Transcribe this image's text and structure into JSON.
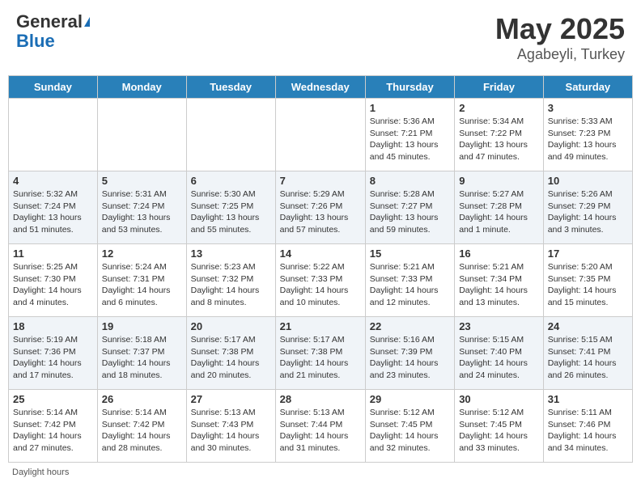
{
  "header": {
    "logo_general": "General",
    "logo_blue": "Blue",
    "month": "May 2025",
    "location": "Agabeyli, Turkey"
  },
  "days_of_week": [
    "Sunday",
    "Monday",
    "Tuesday",
    "Wednesday",
    "Thursday",
    "Friday",
    "Saturday"
  ],
  "weeks": [
    [
      {
        "day": "",
        "sunrise": "",
        "sunset": "",
        "daylight": ""
      },
      {
        "day": "",
        "sunrise": "",
        "sunset": "",
        "daylight": ""
      },
      {
        "day": "",
        "sunrise": "",
        "sunset": "",
        "daylight": ""
      },
      {
        "day": "",
        "sunrise": "",
        "sunset": "",
        "daylight": ""
      },
      {
        "day": "1",
        "sunrise": "Sunrise: 5:36 AM",
        "sunset": "Sunset: 7:21 PM",
        "daylight": "Daylight: 13 hours and 45 minutes."
      },
      {
        "day": "2",
        "sunrise": "Sunrise: 5:34 AM",
        "sunset": "Sunset: 7:22 PM",
        "daylight": "Daylight: 13 hours and 47 minutes."
      },
      {
        "day": "3",
        "sunrise": "Sunrise: 5:33 AM",
        "sunset": "Sunset: 7:23 PM",
        "daylight": "Daylight: 13 hours and 49 minutes."
      }
    ],
    [
      {
        "day": "4",
        "sunrise": "Sunrise: 5:32 AM",
        "sunset": "Sunset: 7:24 PM",
        "daylight": "Daylight: 13 hours and 51 minutes."
      },
      {
        "day": "5",
        "sunrise": "Sunrise: 5:31 AM",
        "sunset": "Sunset: 7:24 PM",
        "daylight": "Daylight: 13 hours and 53 minutes."
      },
      {
        "day": "6",
        "sunrise": "Sunrise: 5:30 AM",
        "sunset": "Sunset: 7:25 PM",
        "daylight": "Daylight: 13 hours and 55 minutes."
      },
      {
        "day": "7",
        "sunrise": "Sunrise: 5:29 AM",
        "sunset": "Sunset: 7:26 PM",
        "daylight": "Daylight: 13 hours and 57 minutes."
      },
      {
        "day": "8",
        "sunrise": "Sunrise: 5:28 AM",
        "sunset": "Sunset: 7:27 PM",
        "daylight": "Daylight: 13 hours and 59 minutes."
      },
      {
        "day": "9",
        "sunrise": "Sunrise: 5:27 AM",
        "sunset": "Sunset: 7:28 PM",
        "daylight": "Daylight: 14 hours and 1 minute."
      },
      {
        "day": "10",
        "sunrise": "Sunrise: 5:26 AM",
        "sunset": "Sunset: 7:29 PM",
        "daylight": "Daylight: 14 hours and 3 minutes."
      }
    ],
    [
      {
        "day": "11",
        "sunrise": "Sunrise: 5:25 AM",
        "sunset": "Sunset: 7:30 PM",
        "daylight": "Daylight: 14 hours and 4 minutes."
      },
      {
        "day": "12",
        "sunrise": "Sunrise: 5:24 AM",
        "sunset": "Sunset: 7:31 PM",
        "daylight": "Daylight: 14 hours and 6 minutes."
      },
      {
        "day": "13",
        "sunrise": "Sunrise: 5:23 AM",
        "sunset": "Sunset: 7:32 PM",
        "daylight": "Daylight: 14 hours and 8 minutes."
      },
      {
        "day": "14",
        "sunrise": "Sunrise: 5:22 AM",
        "sunset": "Sunset: 7:33 PM",
        "daylight": "Daylight: 14 hours and 10 minutes."
      },
      {
        "day": "15",
        "sunrise": "Sunrise: 5:21 AM",
        "sunset": "Sunset: 7:33 PM",
        "daylight": "Daylight: 14 hours and 12 minutes."
      },
      {
        "day": "16",
        "sunrise": "Sunrise: 5:21 AM",
        "sunset": "Sunset: 7:34 PM",
        "daylight": "Daylight: 14 hours and 13 minutes."
      },
      {
        "day": "17",
        "sunrise": "Sunrise: 5:20 AM",
        "sunset": "Sunset: 7:35 PM",
        "daylight": "Daylight: 14 hours and 15 minutes."
      }
    ],
    [
      {
        "day": "18",
        "sunrise": "Sunrise: 5:19 AM",
        "sunset": "Sunset: 7:36 PM",
        "daylight": "Daylight: 14 hours and 17 minutes."
      },
      {
        "day": "19",
        "sunrise": "Sunrise: 5:18 AM",
        "sunset": "Sunset: 7:37 PM",
        "daylight": "Daylight: 14 hours and 18 minutes."
      },
      {
        "day": "20",
        "sunrise": "Sunrise: 5:17 AM",
        "sunset": "Sunset: 7:38 PM",
        "daylight": "Daylight: 14 hours and 20 minutes."
      },
      {
        "day": "21",
        "sunrise": "Sunrise: 5:17 AM",
        "sunset": "Sunset: 7:38 PM",
        "daylight": "Daylight: 14 hours and 21 minutes."
      },
      {
        "day": "22",
        "sunrise": "Sunrise: 5:16 AM",
        "sunset": "Sunset: 7:39 PM",
        "daylight": "Daylight: 14 hours and 23 minutes."
      },
      {
        "day": "23",
        "sunrise": "Sunrise: 5:15 AM",
        "sunset": "Sunset: 7:40 PM",
        "daylight": "Daylight: 14 hours and 24 minutes."
      },
      {
        "day": "24",
        "sunrise": "Sunrise: 5:15 AM",
        "sunset": "Sunset: 7:41 PM",
        "daylight": "Daylight: 14 hours and 26 minutes."
      }
    ],
    [
      {
        "day": "25",
        "sunrise": "Sunrise: 5:14 AM",
        "sunset": "Sunset: 7:42 PM",
        "daylight": "Daylight: 14 hours and 27 minutes."
      },
      {
        "day": "26",
        "sunrise": "Sunrise: 5:14 AM",
        "sunset": "Sunset: 7:42 PM",
        "daylight": "Daylight: 14 hours and 28 minutes."
      },
      {
        "day": "27",
        "sunrise": "Sunrise: 5:13 AM",
        "sunset": "Sunset: 7:43 PM",
        "daylight": "Daylight: 14 hours and 30 minutes."
      },
      {
        "day": "28",
        "sunrise": "Sunrise: 5:13 AM",
        "sunset": "Sunset: 7:44 PM",
        "daylight": "Daylight: 14 hours and 31 minutes."
      },
      {
        "day": "29",
        "sunrise": "Sunrise: 5:12 AM",
        "sunset": "Sunset: 7:45 PM",
        "daylight": "Daylight: 14 hours and 32 minutes."
      },
      {
        "day": "30",
        "sunrise": "Sunrise: 5:12 AM",
        "sunset": "Sunset: 7:45 PM",
        "daylight": "Daylight: 14 hours and 33 minutes."
      },
      {
        "day": "31",
        "sunrise": "Sunrise: 5:11 AM",
        "sunset": "Sunset: 7:46 PM",
        "daylight": "Daylight: 14 hours and 34 minutes."
      }
    ]
  ],
  "footer": {
    "note": "Daylight hours"
  }
}
